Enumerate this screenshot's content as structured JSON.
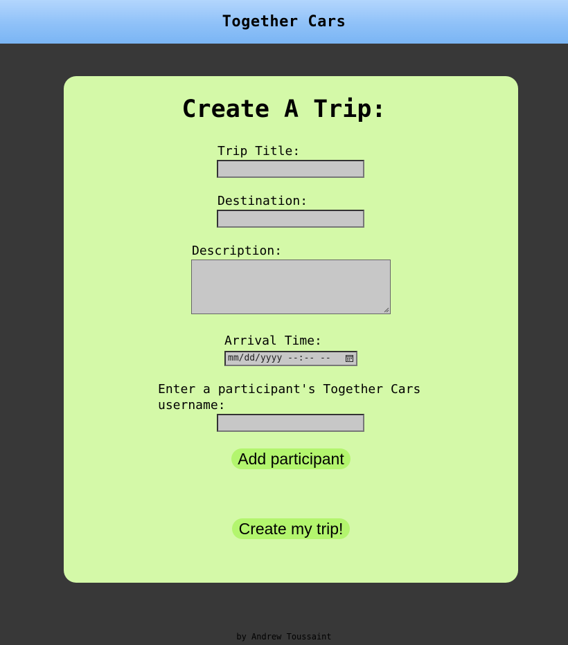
{
  "header": {
    "title": "Together Cars"
  },
  "form": {
    "heading": "Create A Trip:",
    "trip_title": {
      "label": "Trip Title:",
      "value": ""
    },
    "destination": {
      "label": "Destination:",
      "value": ""
    },
    "description": {
      "label": "Description:",
      "value": ""
    },
    "arrival_time": {
      "label": "Arrival Time:",
      "placeholder": "mm/dd/yyyy --:-- --"
    },
    "participant": {
      "label_line1": "Enter a participant's Together Cars",
      "label_line2": "username:",
      "value": ""
    },
    "add_participant_button": "Add participant",
    "create_trip_button": "Create my trip!"
  },
  "footer": {
    "credit": "by Andrew Toussaint"
  },
  "colors": {
    "background": "#383838",
    "card": "#d4f9a8",
    "button": "#b3f56e",
    "input": "#c7c7c7",
    "header_top": "#b3d6fd",
    "header_bottom": "#7ab5f4"
  },
  "icons": {
    "calendar": "calendar-icon",
    "resize": "resize-grip-icon"
  }
}
